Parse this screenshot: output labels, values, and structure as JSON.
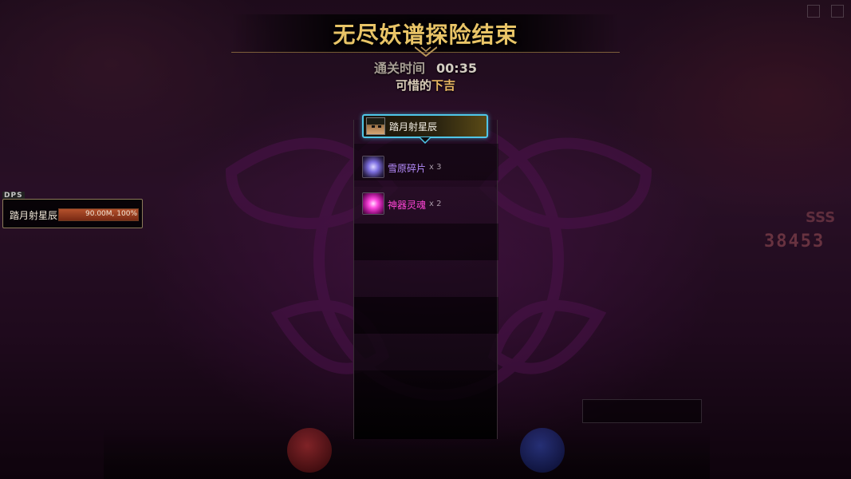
{
  "dialog": {
    "title": "无尽妖谱探险结束",
    "clear_time_label": "通关时间",
    "clear_time_value": "00:35",
    "result_prefix": "可惜的",
    "result_tier": "下吉"
  },
  "rewards": {
    "player_name": "踏月射星辰",
    "items": [
      {
        "name": "雪原碎片",
        "quantity": "x 3",
        "icon": "snow-shard-icon",
        "color": "#b78dff"
      },
      {
        "name": "神器灵魂",
        "quantity": "x 2",
        "icon": "artifact-soul-icon",
        "color": "#ff45d6"
      }
    ]
  },
  "dps": {
    "tag": "DPS",
    "player_name": "踏月射星辰",
    "value": "90.00M, 100%",
    "fill_fraction": 1.0
  },
  "hud": {
    "score": "38453",
    "rank": "SSS"
  },
  "colors": {
    "title_gold": "#e9c467",
    "card_border": "#4fc6e8",
    "rare_item": "#b78dff",
    "epic_item": "#ff45d6"
  }
}
